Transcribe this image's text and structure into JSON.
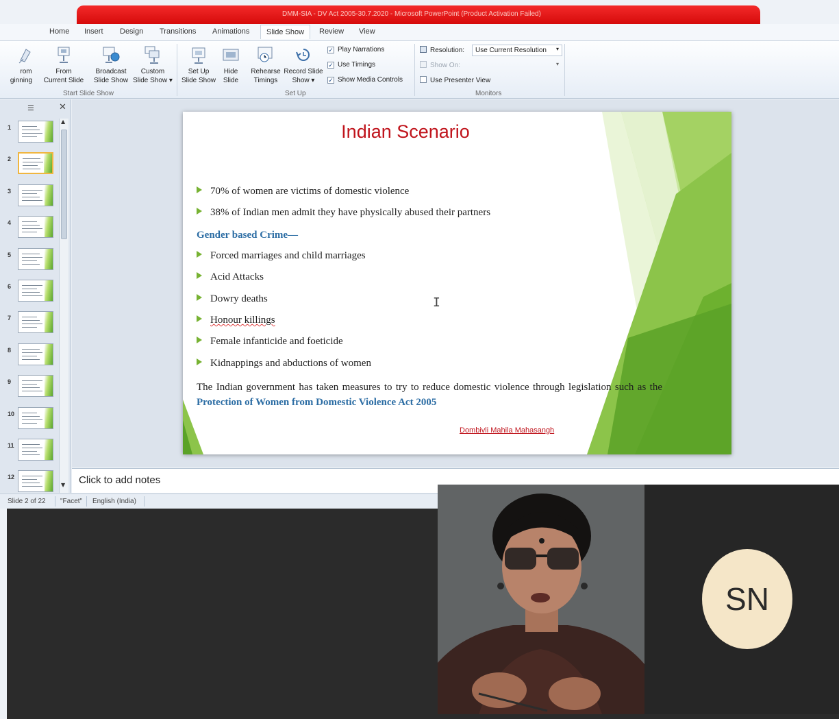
{
  "window": {
    "title": "DMM-SIA - DV Act 2005-30.7.2020 - Microsoft PowerPoint (Product Activation Failed)"
  },
  "ribbon": {
    "tabs": [
      "Home",
      "Insert",
      "Design",
      "Transitions",
      "Animations",
      "Slide Show",
      "Review",
      "View"
    ],
    "active_tab": "Slide Show",
    "start_group": {
      "label": "Start Slide Show",
      "from_beginning": [
        "rom",
        "ginning"
      ],
      "from_current": [
        "From",
        "Current Slide"
      ],
      "broadcast": [
        "Broadcast",
        "Slide Show"
      ],
      "custom": [
        "Custom",
        "Slide Show ▾"
      ]
    },
    "setup_group": {
      "label": "Set Up",
      "setup": [
        "Set Up",
        "Slide Show"
      ],
      "hide": [
        "Hide",
        "Slide"
      ],
      "rehearse": [
        "Rehearse",
        "Timings"
      ],
      "record": [
        "Record Slide",
        "Show ▾"
      ],
      "play_narrations": "Play Narrations",
      "use_timings": "Use Timings",
      "show_media_controls": "Show Media Controls"
    },
    "monitors_group": {
      "label": "Monitors",
      "resolution_label": "Resolution:",
      "resolution_value": "Use Current Resolution",
      "show_on_label": "Show On:",
      "use_presenter_view": "Use Presenter View"
    }
  },
  "slide_pane": {
    "numbers": [
      "1",
      "2",
      "3",
      "4",
      "5",
      "6",
      "7",
      "8",
      "9",
      "10",
      "11",
      "12"
    ],
    "selected": 2
  },
  "slide": {
    "title": "Indian Scenario",
    "bullets_top": [
      "70% of women are victims  of domestic violence",
      "38% of Indian men admit they have physically  abused their partners"
    ],
    "subheading": "Gender based Crime—",
    "bullets_crime": [
      "Forced marriages  and child marriages",
      "Acid Attacks",
      "Dowry deaths",
      "Honour killings",
      "Female infanticide  and foeticide",
      "Kidnappings  and abductions  of women"
    ],
    "paragraph_start": "The Indian government has taken measures to try to reduce domestic violence through legislation such as the ",
    "act_name": "Protection of Women from Domestic Violence Act  2005",
    "signature": "Dombivli Mahila Mahasangh"
  },
  "notes": {
    "placeholder": "Click to add notes"
  },
  "status": {
    "slide_count": "Slide 2 of 22",
    "theme": "\"Facet\"",
    "language": "English (India)"
  },
  "meeting": {
    "participant_initials": "SN",
    "avatar_color": "#f5e6c8"
  }
}
